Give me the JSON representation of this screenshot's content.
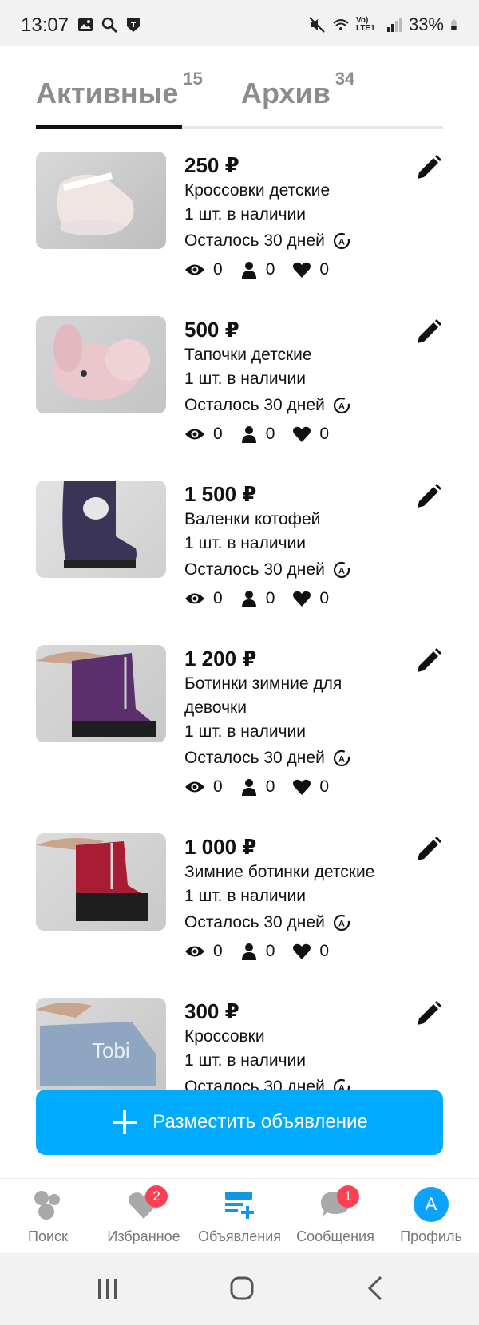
{
  "status_bar": {
    "time": "13:07",
    "battery": "33%",
    "network_label": "Vo) LTE1"
  },
  "tabs": [
    {
      "label": "Активные",
      "count": "15",
      "active": true
    },
    {
      "label": "Архив",
      "count": "34",
      "active": false
    }
  ],
  "listings": [
    {
      "price": "250 ₽",
      "title": "Кроссовки детские",
      "title2": "",
      "stock": "1 шт. в наличии",
      "remaining": "Осталось 30 дней",
      "views": "0",
      "contacts": "0",
      "favorites": "0"
    },
    {
      "price": "500 ₽",
      "title": "Тапочки детские",
      "title2": "",
      "stock": "1 шт. в наличии",
      "remaining": "Осталось 30 дней",
      "views": "0",
      "contacts": "0",
      "favorites": "0"
    },
    {
      "price": "1 500 ₽",
      "title": "Валенки котофей",
      "title2": "",
      "stock": "1 шт. в наличии",
      "remaining": "Осталось 30 дней",
      "views": "0",
      "contacts": "0",
      "favorites": "0"
    },
    {
      "price": "1 200 ₽",
      "title": "Ботинки зимние для",
      "title2": "девочки",
      "stock": "1 шт. в наличии",
      "remaining": "Осталось 30 дней",
      "views": "0",
      "contacts": "0",
      "favorites": "0"
    },
    {
      "price": "1 000 ₽",
      "title": "Зимние ботинки детские",
      "title2": "",
      "stock": "1 шт. в наличии",
      "remaining": "Осталось 30 дней",
      "views": "0",
      "contacts": "0",
      "favorites": "0"
    },
    {
      "price": "300 ₽",
      "title": "Кроссовки",
      "title2": "",
      "stock": "1 шт. в наличии",
      "remaining": "Осталось 30 дней",
      "views": "",
      "contacts": "",
      "favorites": ""
    }
  ],
  "post_button": {
    "label": "Разместить объявление"
  },
  "bottom_nav": [
    {
      "label": "Поиск",
      "icon": "search-circles-icon",
      "badge": ""
    },
    {
      "label": "Избранное",
      "icon": "heart-icon",
      "badge": "2"
    },
    {
      "label": "Объявления",
      "icon": "listings-add-icon",
      "badge": ""
    },
    {
      "label": "Сообщения",
      "icon": "chat-icon",
      "badge": "1"
    },
    {
      "label": "Профиль",
      "icon": "avatar",
      "badge": "",
      "avatar_letter": "А"
    }
  ],
  "colors": {
    "accent": "#00aaff",
    "badge": "#ff4053",
    "avatar": "#0ea2ff"
  }
}
